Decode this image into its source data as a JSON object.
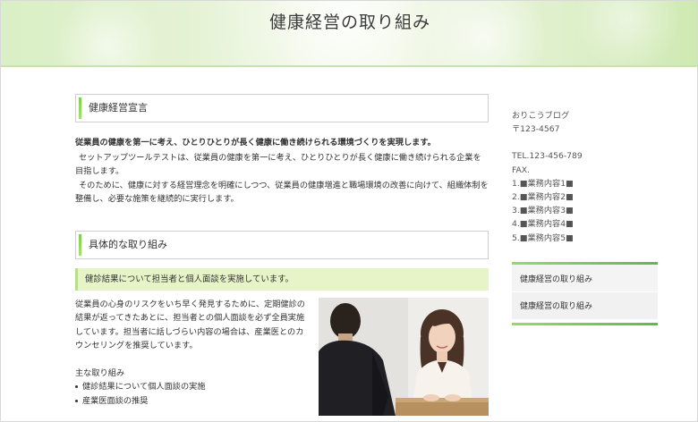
{
  "header": {
    "title": "健康経営の取り組み"
  },
  "main": {
    "section1": {
      "heading": "健康経営宣言",
      "lead": "従業員の健康を第一に考え、ひとりひとりが長く健康に働き続けられる環境づくりを実現します。",
      "paragraph1": "セットアップツールテストは、従業員の健康を第一に考え、ひとりひとりが長く健康に働き続けられる企業を目指します。",
      "paragraph2": "そのために、健康に対する経営理念を明確にしつつ、従業員の健康増進と職場環境の改善に向けて、組織体制を整備し、必要な施策を継続的に実行します。"
    },
    "section2": {
      "heading": "具体的な取り組み",
      "subheading": "健診結果について担当者と個人面談を実施しています。",
      "paragraph": "従業員の心身のリスクをいち早く発見するために、定期健診の結果が返ってきたあとに、担当者との個人面談を必ず全員実施しています。担当者に話しづらい内容の場合は、産業医とのカウンセリングを推奨しています。",
      "list_heading": "主な取り組み",
      "list": [
        "健診結果について個人面談の実施",
        "産業医面談の推奨"
      ]
    }
  },
  "sidebar": {
    "company": "おりこうブログ",
    "postal": "〒123-4567",
    "tel": "TEL.123-456-789",
    "fax": "FAX.",
    "services": [
      "1.■業務内容1■",
      "2.■業務内容2■",
      "3.■業務内容3■",
      "4.■業務内容4■",
      "5.■業務内容5■"
    ],
    "menu": [
      "健康経営の取り組み",
      "健康経営の取り組み"
    ]
  },
  "colors": {
    "accent": "#7ed04b",
    "subheading_bg": "#e6f4c8",
    "menu_bg": "#f4f4f4"
  }
}
